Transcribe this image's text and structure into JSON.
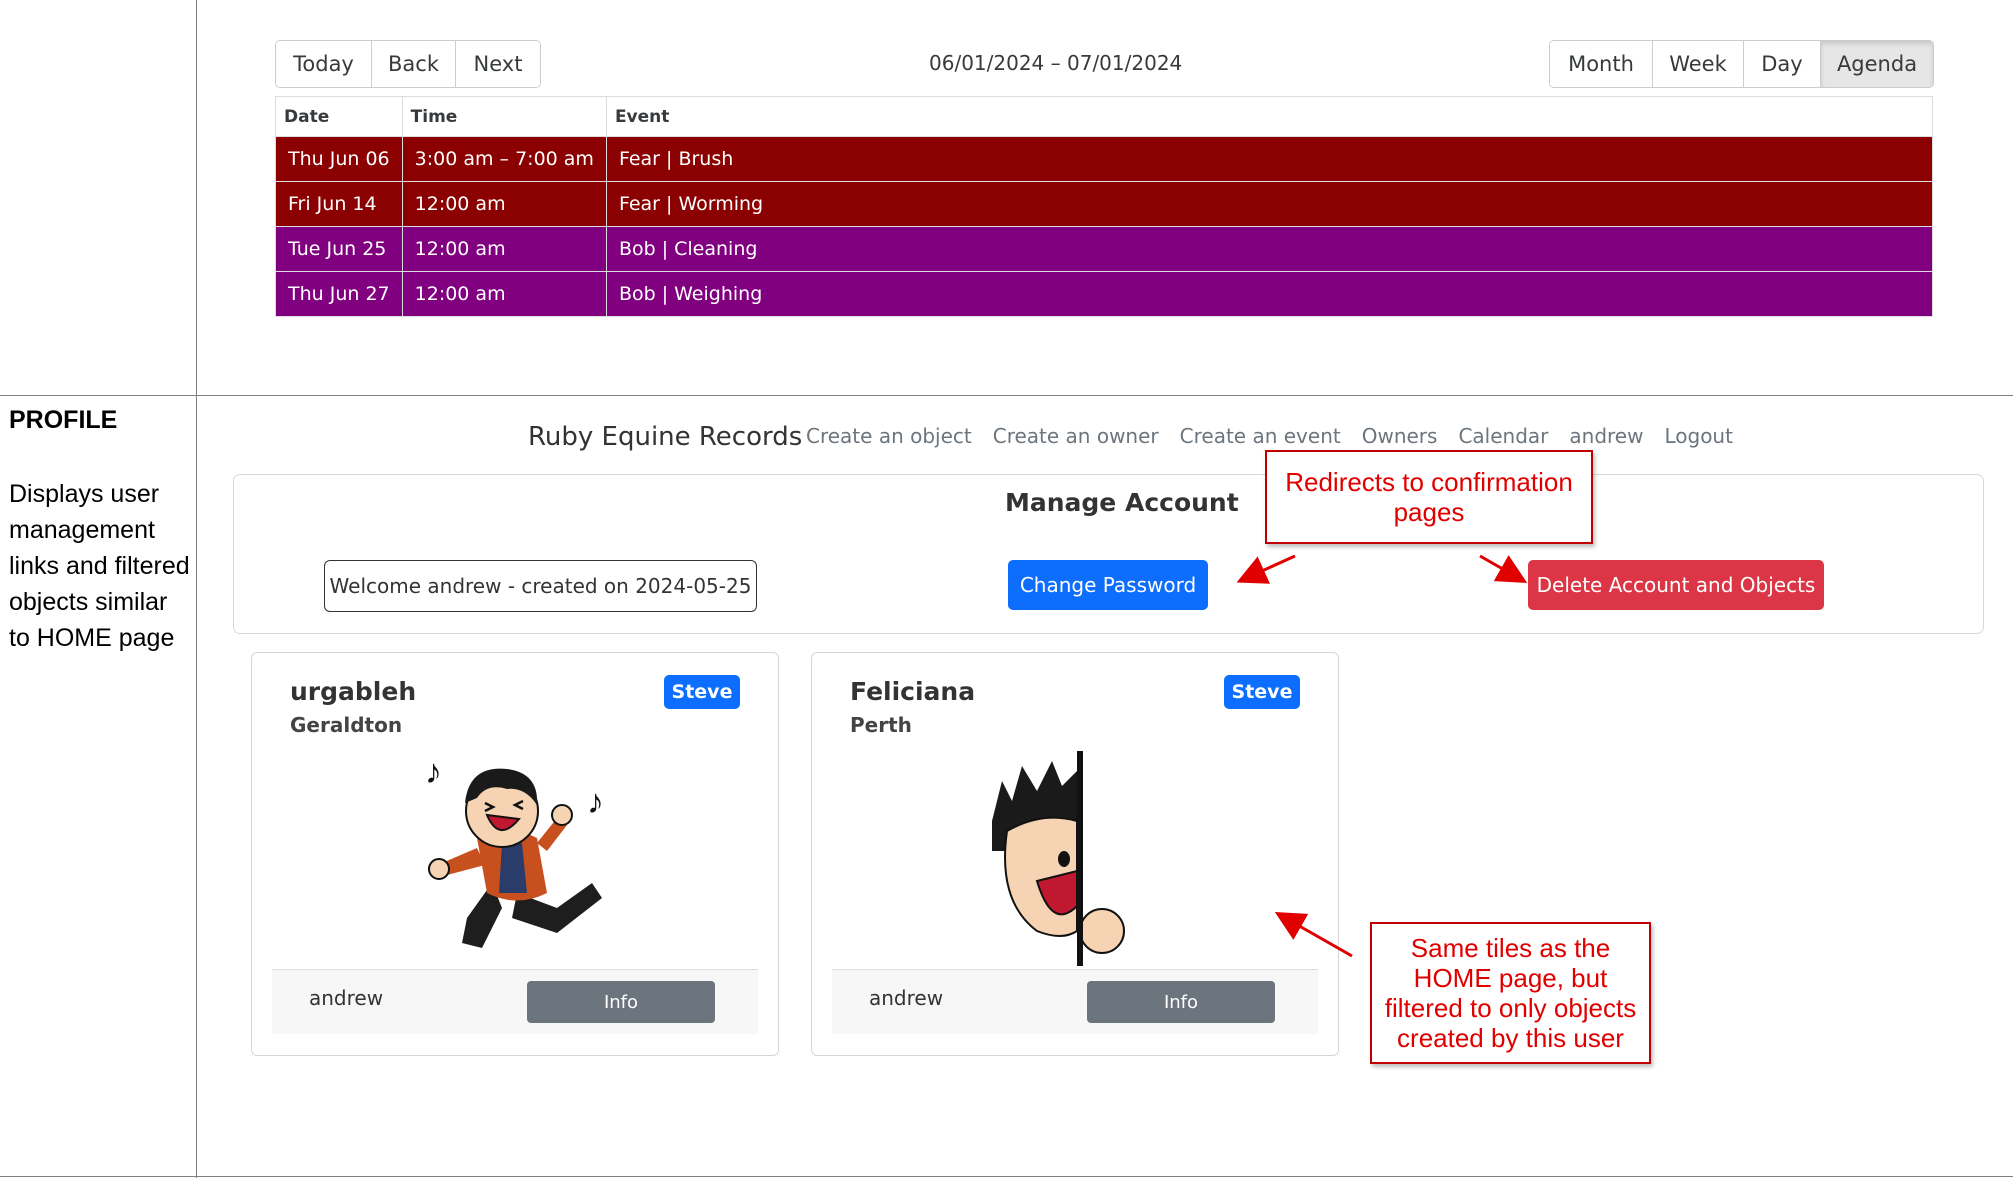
{
  "calendar": {
    "nav_buttons": [
      "Today",
      "Back",
      "Next"
    ],
    "date_range": "06/01/2024 – 07/01/2024",
    "view_buttons": [
      "Month",
      "Week",
      "Day",
      "Agenda"
    ],
    "active_view": "Agenda",
    "columns": [
      "Date",
      "Time",
      "Event"
    ],
    "events": [
      {
        "date": "Thu Jun 06",
        "time": "3:00 am – 7:00 am",
        "event": "Fear | Brush",
        "color": "#8b0000"
      },
      {
        "date": "Fri Jun 14",
        "time": "12:00 am",
        "event": "Fear | Worming",
        "color": "#8b0000"
      },
      {
        "date": "Tue Jun 25",
        "time": "12:00 am",
        "event": "Bob | Cleaning",
        "color": "#800080"
      },
      {
        "date": "Thu Jun 27",
        "time": "12:00 am",
        "event": "Bob | Weighing",
        "color": "#800080"
      }
    ]
  },
  "doc": {
    "section_title": "PROFILE",
    "description": "Displays user management links and filtered objects similar to HOME page"
  },
  "navbar": {
    "brand": "Ruby Equine Records",
    "links": [
      "Create an object",
      "Create an owner",
      "Create an event",
      "Owners",
      "Calendar",
      "andrew",
      "Logout"
    ]
  },
  "manage": {
    "title": "Manage Account",
    "welcome": "Welcome andrew - created on 2024-05-25",
    "change_password": "Change Password",
    "delete_account": "Delete Account and Objects"
  },
  "callouts": {
    "redirect": "Redirects to confirmation pages",
    "tiles": "Same tiles as the HOME page, but filtered to only objects created by this user"
  },
  "tiles": [
    {
      "name": "urgableh",
      "location": "Geraldton",
      "badge": "Steve",
      "owner": "andrew",
      "info_label": "Info"
    },
    {
      "name": "Feliciana",
      "location": "Perth",
      "badge": "Steve",
      "owner": "andrew",
      "info_label": "Info"
    }
  ],
  "colors": {
    "primary": "#0d6efd",
    "danger": "#dc3545",
    "secondary": "#6c757d",
    "event_red": "#8b0000",
    "event_purple": "#800080",
    "callout": "#e00000"
  }
}
